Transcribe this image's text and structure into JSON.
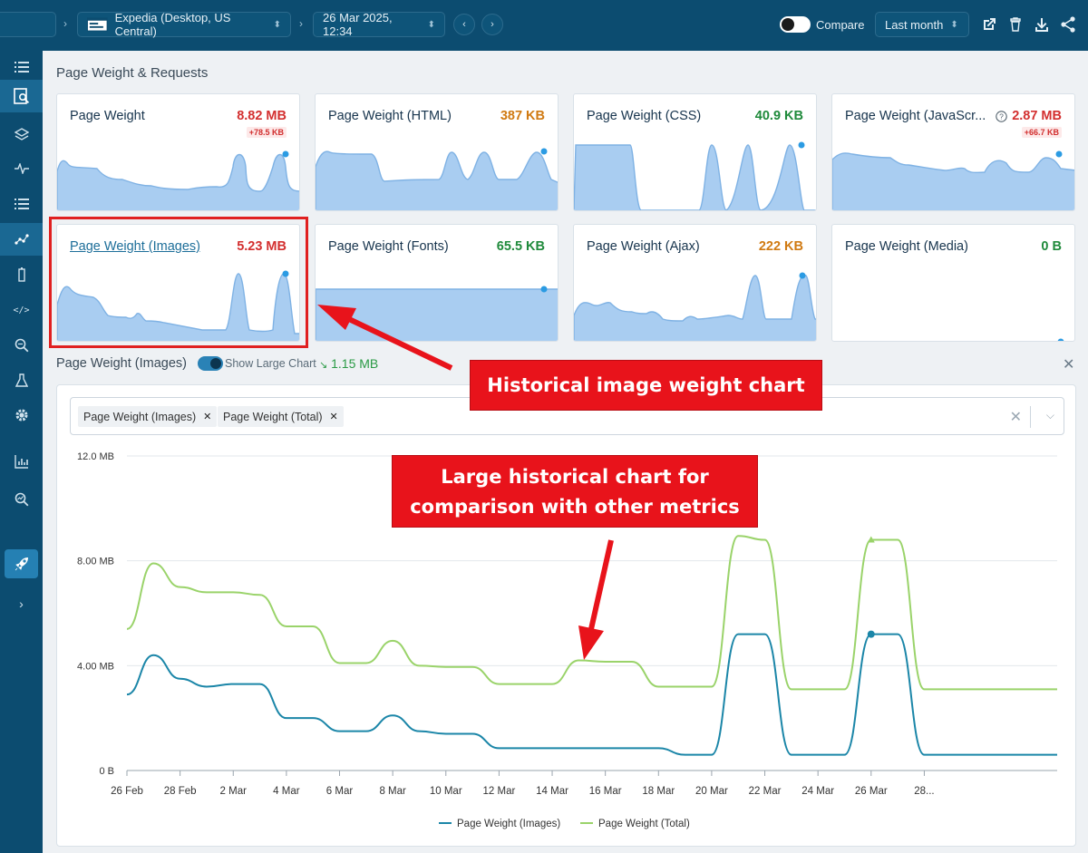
{
  "topbar": {
    "site_label": "Expedia (Desktop, US Central)",
    "date_label": "26 Mar 2025, 12:34",
    "compare_label": "Compare",
    "range_label": "Last month"
  },
  "section_title": "Page Weight & Requests",
  "cards": [
    {
      "title": "Page Weight",
      "value": "8.82 MB",
      "delta": "+78.5 KB",
      "color": "#d32f2f"
    },
    {
      "title": "Page Weight (HTML)",
      "value": "387 KB",
      "delta": "",
      "color": "#d07a12"
    },
    {
      "title": "Page Weight (CSS)",
      "value": "40.9 KB",
      "delta": "",
      "color": "#1f8a3b"
    },
    {
      "title": "Page Weight (JavaScr...",
      "value": "2.87 MB",
      "delta": "+66.7 KB",
      "color": "#d32f2f"
    },
    {
      "title": "Page Weight (Images)",
      "value": "5.23 MB",
      "delta": "",
      "color": "#d32f2f"
    },
    {
      "title": "Page Weight (Fonts)",
      "value": "65.5 KB",
      "delta": "",
      "color": "#1f8a3b"
    },
    {
      "title": "Page Weight (Ajax)",
      "value": "222 KB",
      "delta": "",
      "color": "#d07a12"
    },
    {
      "title": "Page Weight (Media)",
      "value": "0 B",
      "delta": "",
      "color": "#1f8a3b"
    }
  ],
  "detail": {
    "title": "Page Weight (Images)",
    "show_large_label": "Show Large Chart",
    "trend_value": "1.15 MB",
    "chips": [
      "Page Weight (Images)",
      "Page Weight (Total)"
    ]
  },
  "callouts": {
    "top": "Historical image weight chart",
    "bottom_line1": "Large historical chart for",
    "bottom_line2": "comparison with other metrics"
  },
  "chart_data": {
    "type": "line",
    "y_ticks": [
      "12.0 MB",
      "8.00 MB",
      "4.00 MB",
      "0 B"
    ],
    "ylim": [
      0,
      12
    ],
    "x_ticks": [
      "26 Feb",
      "28 Feb",
      "2 Mar",
      "4 Mar",
      "6 Mar",
      "8 Mar",
      "10 Mar",
      "12 Mar",
      "14 Mar",
      "16 Mar",
      "18 Mar",
      "20 Mar",
      "22 Mar",
      "24 Mar",
      "26 Mar",
      "28..."
    ],
    "x": [
      0,
      1,
      2,
      3,
      4,
      5,
      6,
      7,
      8,
      9,
      10,
      11,
      12,
      13,
      14,
      15,
      16,
      17,
      18,
      19,
      20,
      21,
      22,
      23,
      24,
      25,
      26,
      27,
      28,
      29,
      30,
      31,
      32,
      33,
      34,
      35
    ],
    "series": [
      {
        "name": "Page Weight (Images)",
        "color": "#1b86a8",
        "values": [
          2.9,
          4.4,
          3.5,
          3.2,
          3.3,
          3.3,
          2.0,
          2.0,
          1.5,
          1.5,
          2.1,
          1.5,
          1.4,
          1.4,
          0.85,
          0.85,
          0.85,
          0.85,
          0.85,
          0.85,
          0.85,
          0.6,
          0.6,
          5.2,
          5.2,
          0.6,
          0.6,
          0.6,
          5.2,
          5.2,
          0.6,
          0.6,
          0.6,
          0.6,
          0.6,
          0.6
        ]
      },
      {
        "name": "Page Weight (Total)",
        "color": "#9ad36a",
        "values": [
          5.4,
          7.9,
          7.0,
          6.8,
          6.8,
          6.7,
          5.5,
          5.5,
          4.1,
          4.1,
          4.95,
          4.0,
          3.95,
          3.95,
          3.3,
          3.3,
          3.3,
          4.2,
          4.15,
          4.15,
          3.2,
          3.2,
          3.2,
          8.95,
          8.8,
          3.1,
          3.1,
          3.1,
          8.8,
          8.8,
          3.1,
          3.1,
          3.1,
          3.1,
          3.1,
          3.1
        ]
      }
    ]
  }
}
